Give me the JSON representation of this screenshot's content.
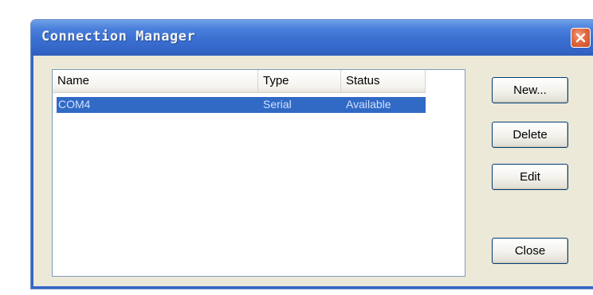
{
  "window": {
    "title": "Connection Manager"
  },
  "list": {
    "columns": [
      "Name",
      "Type",
      "Status"
    ],
    "rows": [
      {
        "name": "COM4",
        "type": "Serial",
        "status": "Available",
        "selected": true
      }
    ]
  },
  "buttons": {
    "new_label": "New...",
    "delete_label": "Delete",
    "edit_label": "Edit",
    "close_label": "Close"
  },
  "icons": {
    "close": "close-icon"
  },
  "colors": {
    "titlebar": "#3567c9",
    "selection": "#316ac5",
    "close_button": "#d9582e",
    "dialog_face": "#ece9d8"
  }
}
